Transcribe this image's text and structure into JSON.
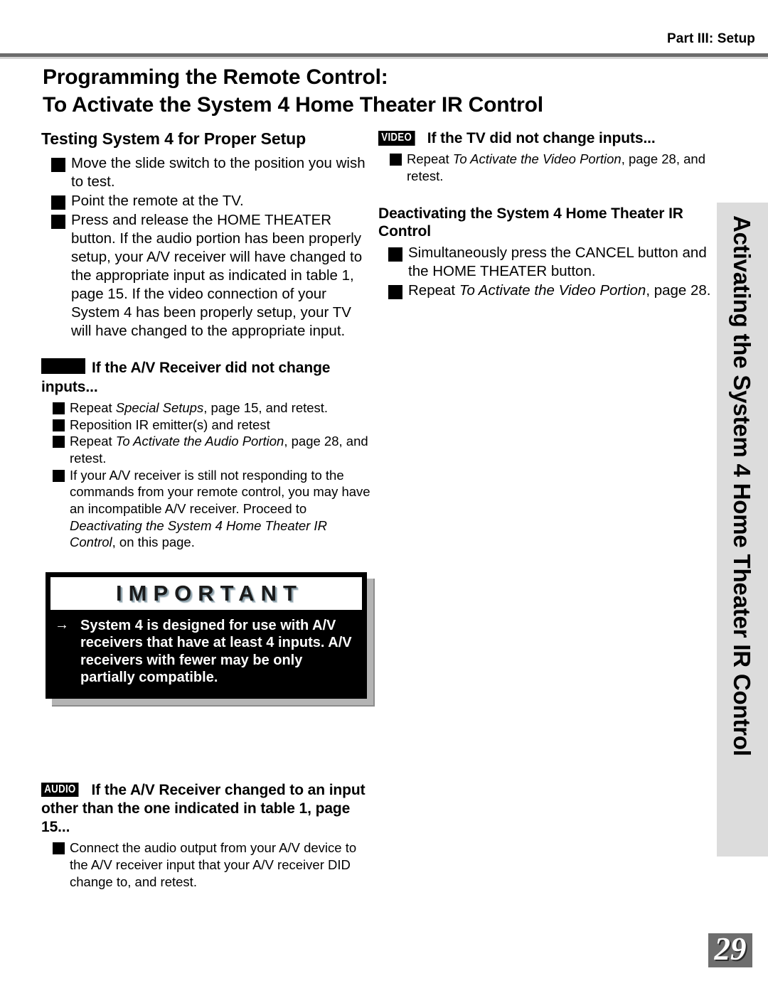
{
  "header": {
    "part_label": "Part III: Setup"
  },
  "title": {
    "line1": "Programming the Remote Control:",
    "line2": "To Activate the System 4 Home Theater IR Control"
  },
  "left_column": {
    "section_heading": "Testing System 4 for Proper Setup",
    "steps": [
      "Move the slide switch to the position you wish to test.",
      "Point the remote at the TV.",
      "Press and release the HOME THEATER button.  If the audio portion has been properly setup, your A/V receiver will have changed to the appropriate input as indicated in table 1, page 15.  If the video connection of your System 4 has been properly setup, your TV will have changed to the appropriate input."
    ],
    "troubleshoot_av": {
      "badge": "",
      "heading": "If the A/V Receiver did not change inputs...",
      "items": [
        {
          "before": "Repeat ",
          "italic": "Special Setups",
          "after": ", page 15, and retest."
        },
        {
          "before": "Reposition IR emitter(s) and retest",
          "italic": "",
          "after": ""
        },
        {
          "before": "Repeat ",
          "italic": "To Activate the Audio Portion",
          "after": ", page 28, and retest."
        },
        {
          "before": "If your A/V receiver is still not responding to the commands from your remote control, you may have an incompatible A/V receiver. Proceed to ",
          "italic": "Deactivating the System 4 Home Theater IR Control",
          "after": ", on this page."
        }
      ]
    },
    "important": {
      "title": "IMPORTANT",
      "arrow": "→",
      "text": "System 4 is designed for use with A/V receivers that have at least 4 inputs.  A/V receivers with fewer may be only partially compatible."
    },
    "audio_section": {
      "badge": "AUDIO",
      "heading": "If the A/V Receiver changed to an input other than the one indicated in table 1, page 15...",
      "items": [
        {
          "before": "Connect the audio output from your A/V device to the A/V receiver input that your A/V receiver DID change to, and retest.",
          "italic": "",
          "after": ""
        }
      ]
    }
  },
  "right_column": {
    "video_section": {
      "badge": "VIDEO",
      "heading": "If the TV did not change inputs...",
      "items": [
        {
          "before": "Repeat ",
          "italic": "To Activate the Video Portion",
          "after": ", page 28, and retest."
        }
      ]
    },
    "deactivating": {
      "heading": "Deactivating the System 4 Home Theater IR Control",
      "items": [
        {
          "before": "Simultaneously press the CANCEL button and the HOME THEATER button.",
          "italic": "",
          "after": ""
        },
        {
          "before": "Repeat ",
          "italic": "To Activate the Video Portion",
          "after": ", page 28."
        }
      ]
    }
  },
  "side_tab": {
    "label": "Activating the System 4 Home Theater IR Control",
    "background_color": "#dcdcdc"
  },
  "footer": {
    "page_number": "29",
    "background_color": "#6e6e6e"
  }
}
